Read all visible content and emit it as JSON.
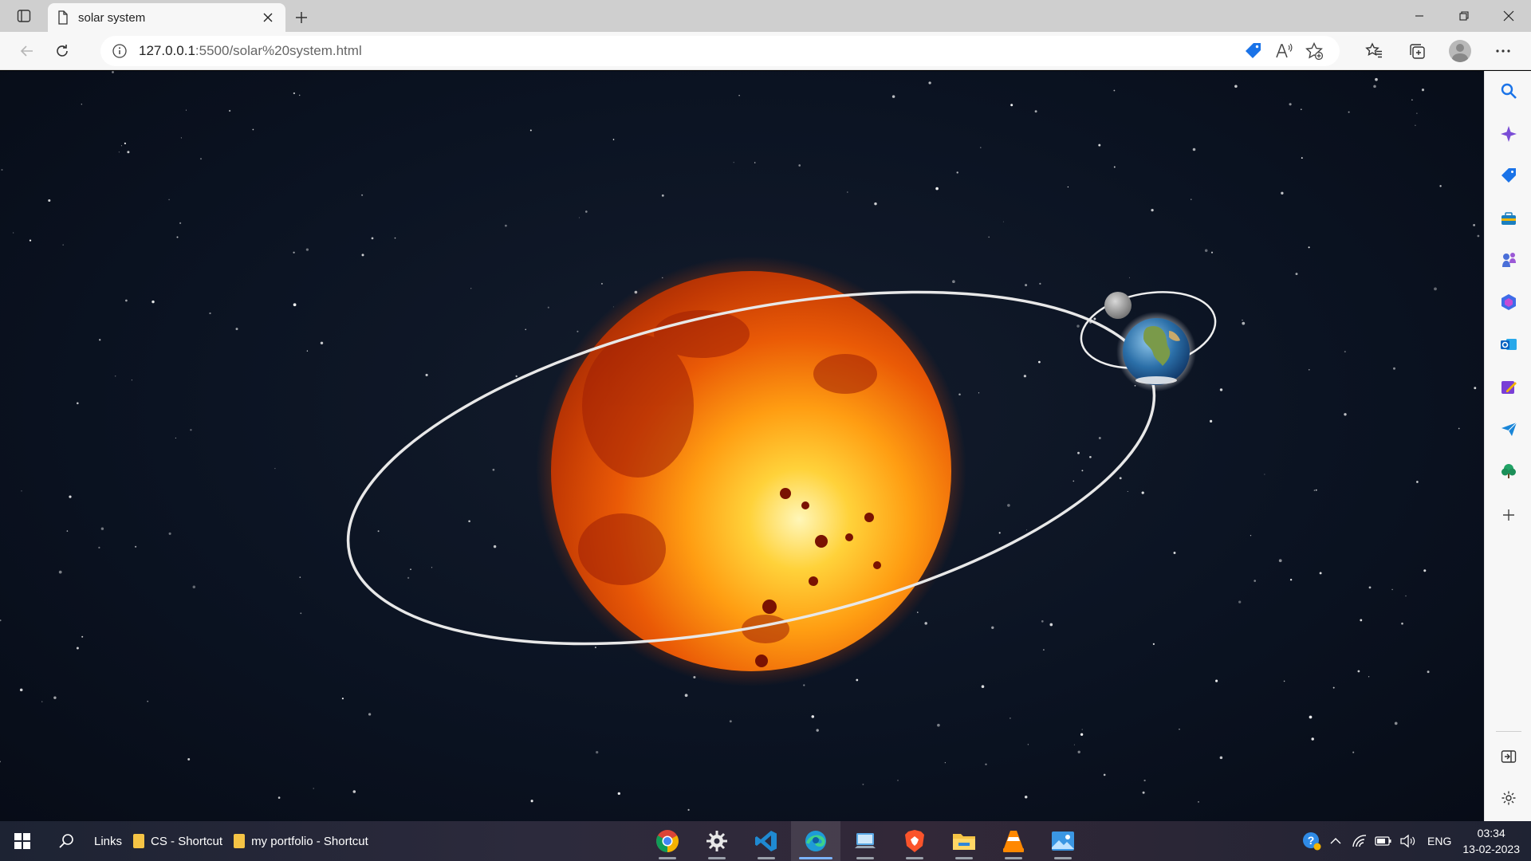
{
  "browser": {
    "tab": {
      "title": "solar system",
      "icon": "page-icon"
    },
    "address": {
      "host": "127.0.0.1",
      "rest": ":5500/solar%20system.html"
    },
    "toolbar_icons": [
      "shopping-tag-icon",
      "read-aloud-icon",
      "add-favorite-icon",
      "favorites-icon",
      "collections-icon",
      "profile-avatar",
      "more-icon"
    ]
  },
  "sidebar": {
    "items": [
      "search-icon",
      "copilot-icon",
      "shopping-icon",
      "tools-icon",
      "games-icon",
      "office-icon",
      "outlook-icon",
      "designer-icon",
      "send-icon",
      "tree-icon",
      "add-icon",
      "split-screen-icon",
      "settings-icon"
    ]
  },
  "scene": {
    "objects": [
      "sun",
      "earth",
      "moon",
      "earth-orbit",
      "moon-orbit",
      "starfield"
    ]
  },
  "taskbar": {
    "links_label": "Links",
    "shortcuts": [
      {
        "label": "CS - Shortcut"
      },
      {
        "label": "my portfolio - Shortcut"
      }
    ],
    "apps": [
      "chrome",
      "settings",
      "vscode",
      "edge",
      "remote-desktop",
      "brave",
      "file-explorer",
      "vlc",
      "photos"
    ],
    "active_app": "edge",
    "language": "ENG",
    "time": "03:34",
    "date": "13-02-2023"
  }
}
